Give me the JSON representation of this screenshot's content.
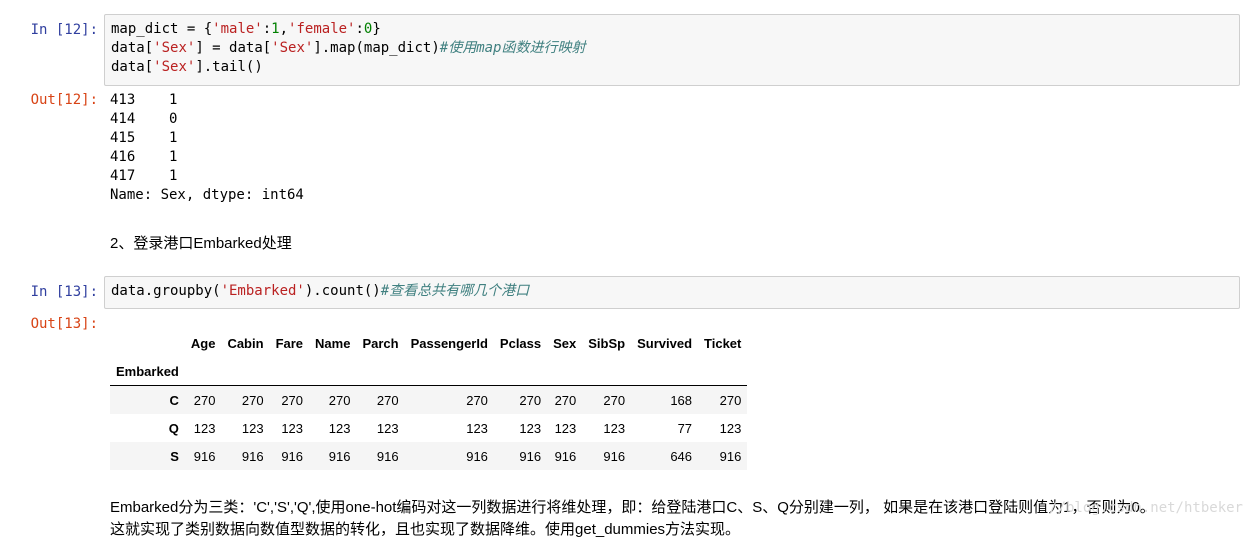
{
  "cell12": {
    "in_prompt": "In [12]:",
    "out_prompt": "Out[12]:",
    "code": {
      "l1_a": "map_dict = {",
      "l1_s1": "'male'",
      "l1_b": ":",
      "l1_n1": "1",
      "l1_c": ",",
      "l1_s2": "'female'",
      "l1_d": ":",
      "l1_n2": "0",
      "l1_e": "}",
      "l2_a": "data[",
      "l2_s1": "'Sex'",
      "l2_b": "] = data[",
      "l2_s2": "'Sex'",
      "l2_c": "].map(map_dict)",
      "l2_cmt": "#使用map函数进行映射",
      "l3_a": "data[",
      "l3_s1": "'Sex'",
      "l3_b": "].tail()"
    },
    "output_lines": [
      "413    1",
      "414    0",
      "415    1",
      "416    1",
      "417    1",
      "Name: Sex, dtype: int64"
    ]
  },
  "markdown1": "2、登录港口Embarked处理",
  "cell13": {
    "in_prompt": "In [13]:",
    "out_prompt": "Out[13]:",
    "code": {
      "a": "data.groupby(",
      "s1": "'Embarked'",
      "b": ").count()",
      "cmt": "#查看总共有哪几个港口"
    },
    "table": {
      "index_name": "Embarked",
      "columns": [
        "Age",
        "Cabin",
        "Fare",
        "Name",
        "Parch",
        "PassengerId",
        "Pclass",
        "Sex",
        "SibSp",
        "Survived",
        "Ticket"
      ],
      "rows": [
        {
          "index": "C",
          "values": [
            "270",
            "270",
            "270",
            "270",
            "270",
            "270",
            "270",
            "270",
            "270",
            "168",
            "270"
          ]
        },
        {
          "index": "Q",
          "values": [
            "123",
            "123",
            "123",
            "123",
            "123",
            "123",
            "123",
            "123",
            "123",
            "77",
            "123"
          ]
        },
        {
          "index": "S",
          "values": [
            "916",
            "916",
            "916",
            "916",
            "916",
            "916",
            "916",
            "916",
            "916",
            "646",
            "916"
          ]
        }
      ]
    }
  },
  "markdown2": {
    "line1": "Embarked分为三类：'C','S','Q',使用one-hot编码对这一列数据进行将维处理，即：给登陆港口C、S、Q分别建一列， 如果是在该港口登陆则值为1，否则为0。",
    "line2": "这就实现了类别数据向数值型数据的转化，且也实现了数据降维。使用get_dummies方法实现。"
  },
  "watermark": "//blog.csdn.net/htbeker"
}
